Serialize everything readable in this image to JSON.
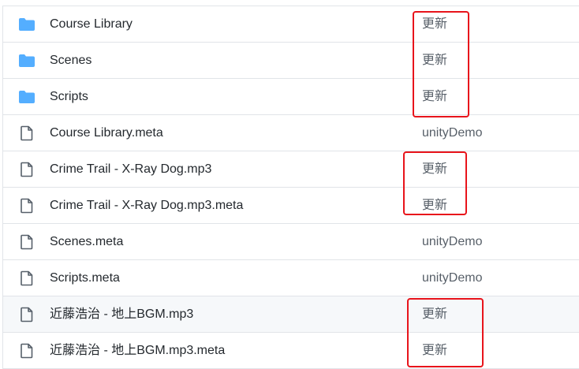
{
  "files": [
    {
      "type": "folder",
      "name": "Course Library",
      "commit": "更新"
    },
    {
      "type": "folder",
      "name": "Scenes",
      "commit": "更新"
    },
    {
      "type": "folder",
      "name": "Scripts",
      "commit": "更新"
    },
    {
      "type": "file",
      "name": "Course Library.meta",
      "commit": "unityDemo"
    },
    {
      "type": "file",
      "name": "Crime Trail - X-Ray Dog.mp3",
      "commit": "更新"
    },
    {
      "type": "file",
      "name": "Crime Trail - X-Ray Dog.mp3.meta",
      "commit": "更新"
    },
    {
      "type": "file",
      "name": "Scenes.meta",
      "commit": "unityDemo"
    },
    {
      "type": "file",
      "name": "Scripts.meta",
      "commit": "unityDemo"
    },
    {
      "type": "file",
      "name": "近藤浩治 - 地上BGM.mp3",
      "commit": "更新"
    },
    {
      "type": "file",
      "name": "近藤浩治 - 地上BGM.mp3.meta",
      "commit": "更新"
    }
  ],
  "colors": {
    "folder_icon": "#54aeff",
    "file_icon": "#57606a",
    "annotation": "#e8141b",
    "row_hover": "#f6f8fa"
  }
}
